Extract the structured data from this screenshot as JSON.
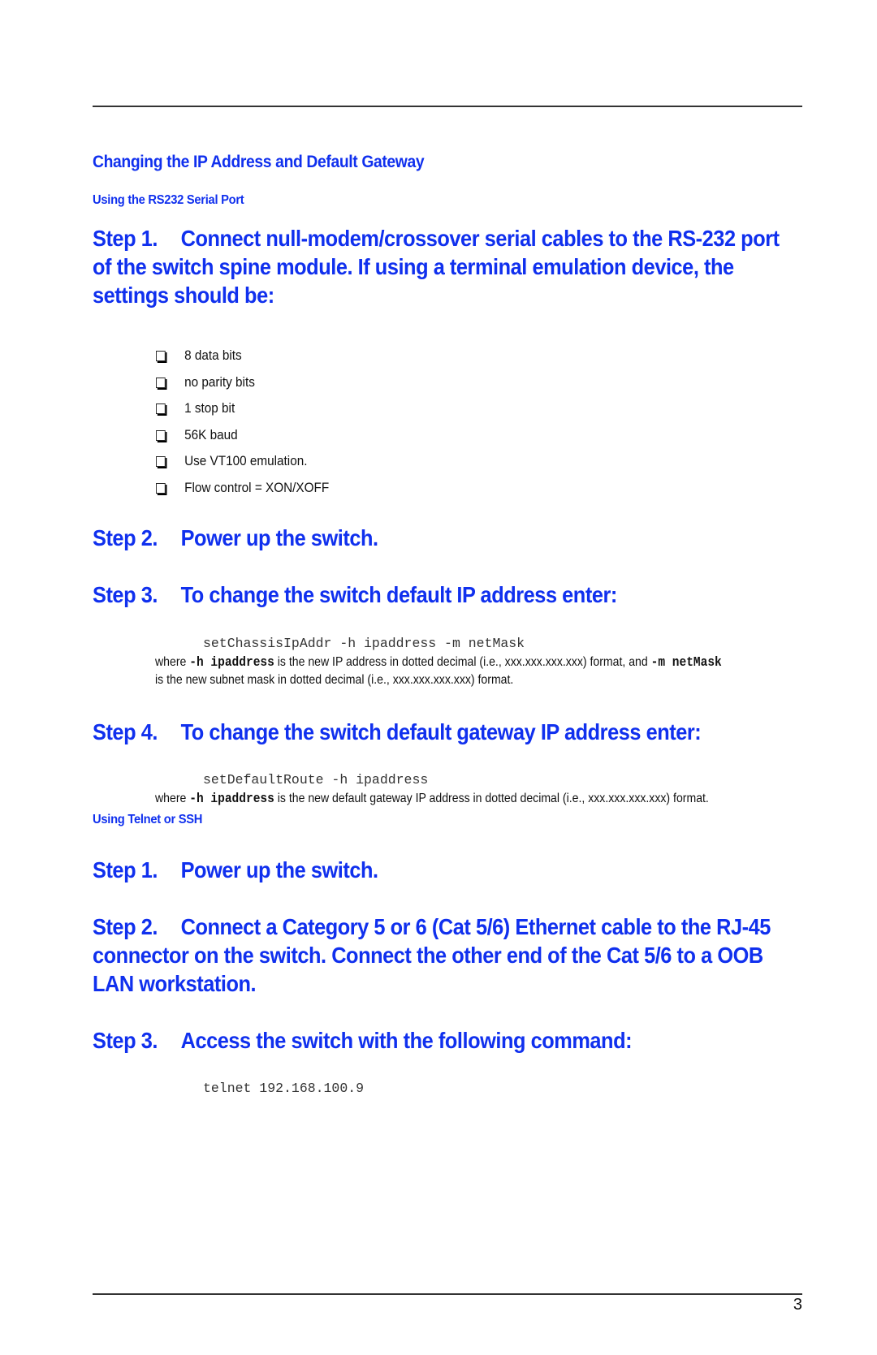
{
  "section_title": "Changing the IP Address and Default Gateway",
  "rs232": {
    "subtitle": "Using the RS232 Serial Port",
    "steps": [
      {
        "number": "Step 1.",
        "text": "Connect null-modem/crossover serial cables to the RS-232 port of the switch spine module. If using a terminal emulation device, the settings should be:"
      },
      {
        "number": "Step 2.",
        "text": "Power up the switch."
      },
      {
        "number": "Step 3.",
        "text": "To change the switch default IP address enter:"
      },
      {
        "number": "Step 4.",
        "text": "To change the switch default gateway IP address enter:"
      }
    ],
    "settings": [
      "8 data bits",
      "no parity bits",
      "1 stop bit",
      "56K baud",
      "Use VT100 emulation.",
      "Flow control = XON/XOFF"
    ],
    "ip_command": "setChassisIpAddr -h ipaddress -m netMask",
    "ip_desc": {
      "where": "where ",
      "h_flag": "-h ipaddress",
      "part1": " is the new IP address in dotted decimal (i.e., xxx.xxx.xxx.xxx) format, and ",
      "m_flag": "-m netMask",
      "part2": "is the new subnet mask in dotted decimal (i.e., xxx.xxx.xxx.xxx) format."
    },
    "gw_command": "setDefaultRoute -h ipaddress",
    "gw_desc": {
      "where": "where ",
      "h_flag": "-h ipaddress",
      "part1": " is the new default gateway IP address in dotted decimal (i.e., xxx.xxx.xxx.xxx) format."
    }
  },
  "telnet": {
    "subtitle": "Using Telnet or SSH",
    "steps": [
      {
        "number": "Step 1.",
        "text": "Power up the switch."
      },
      {
        "number": "Step 2.",
        "text": "Connect a Category 5 or 6 (Cat 5/6) Ethernet cable to the RJ-45 connector on the switch. Connect the other end of the Cat 5/6 to a OOB LAN workstation."
      },
      {
        "number": "Step 3.",
        "text": "Access the switch with the following command:"
      }
    ],
    "command": "telnet 192.168.100.9"
  },
  "page_number": "3",
  "colors": {
    "heading_blue": "#1030ee",
    "body_text": "#111111"
  }
}
